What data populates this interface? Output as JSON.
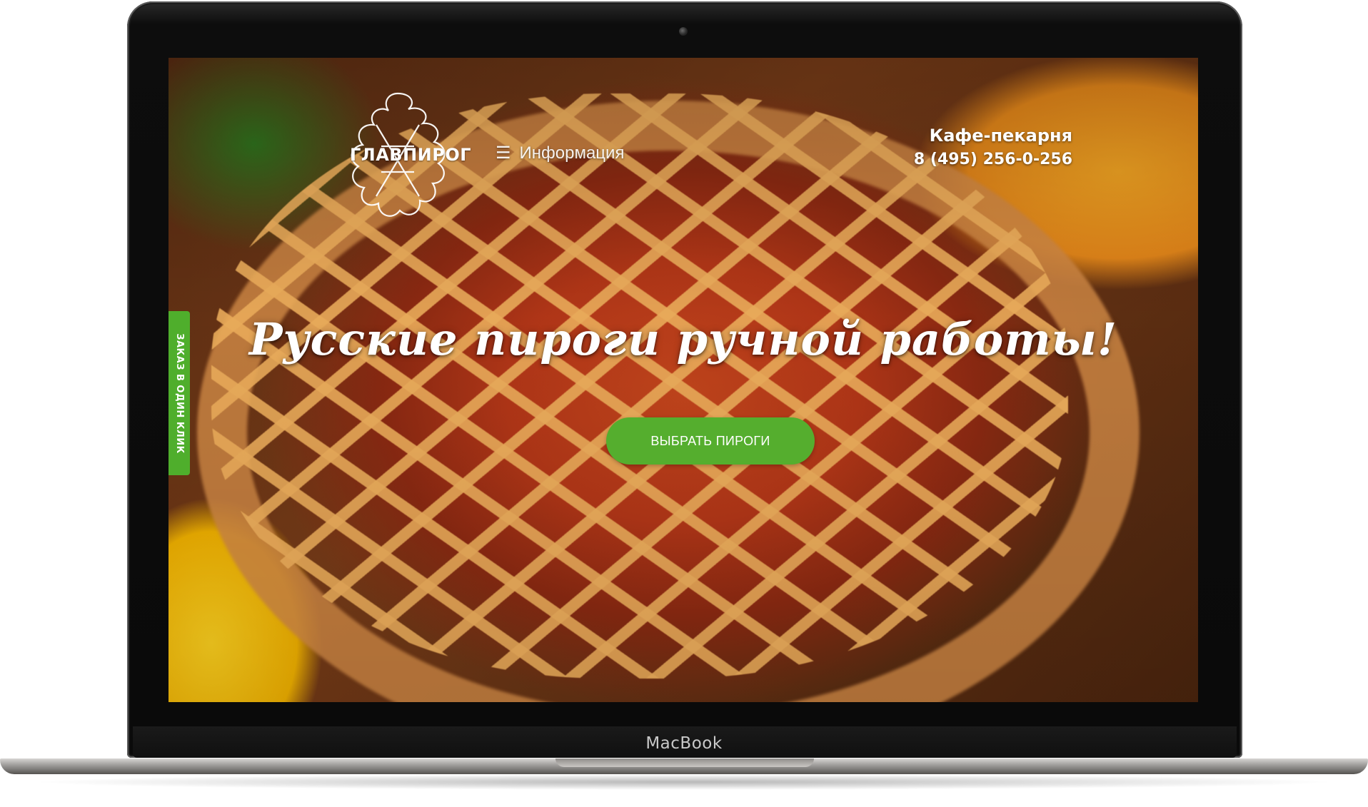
{
  "device": {
    "brand_label": "MacBook"
  },
  "site": {
    "logo_text": "ГЛАВПИРОГ",
    "menu": {
      "icon": "menu-icon",
      "label": "Информация"
    },
    "contact": {
      "title": "Кафе-пекарня",
      "phone": "8 (495) 256-0-256"
    },
    "side_tab_label": "ЗАКАЗ В ОДИН КЛИК",
    "headline": "Русские пироги ручной работы!",
    "cta_label": "ВЫБРАТЬ ПИРОГИ"
  },
  "colors": {
    "accent_green": "#55ae2e",
    "text_white": "#ffffff"
  }
}
